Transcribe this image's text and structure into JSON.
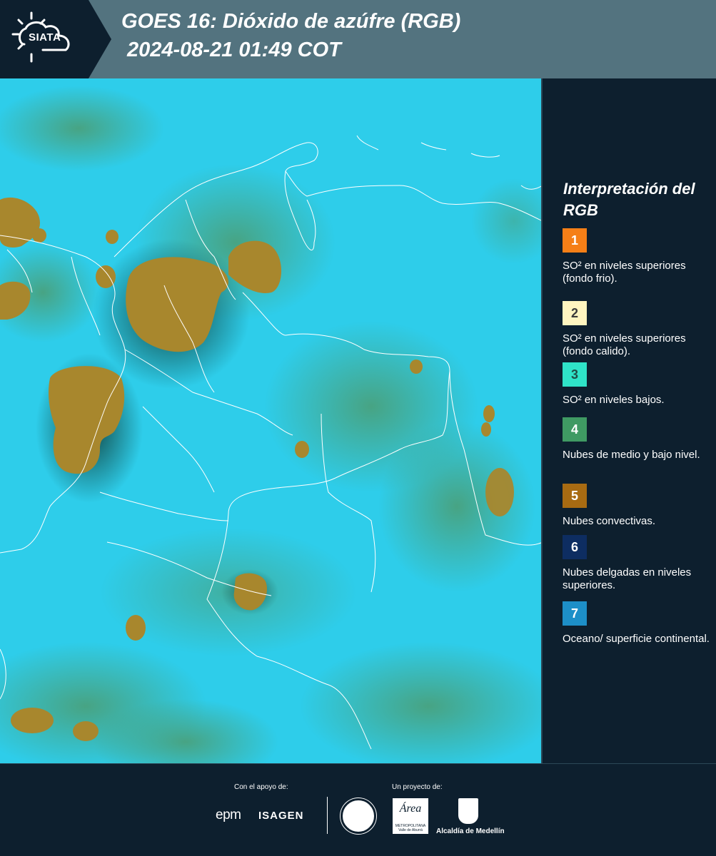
{
  "header": {
    "logo_text": "SIATA",
    "title_line1": "GOES 16: Dióxido de azúfre (RGB)",
    "title_line2": "2024-08-21 01:49 COT"
  },
  "legend": {
    "title": "Interpretación del RGB",
    "items": [
      {
        "number": "1",
        "text": "SO² en niveles superiores (fondo frio).",
        "color": "#f57f17",
        "text_color": "#ffffff"
      },
      {
        "number": "2",
        "text": "SO² en niveles superiores (fondo calido).",
        "color": "#fff5c0",
        "text_color": "#3a3a3a"
      },
      {
        "number": "3",
        "text": "SO² en niveles bajos.",
        "color": "#2fe3c8",
        "text_color": "#1f4d47"
      },
      {
        "number": "4",
        "text": "Nubes de medio y bajo nivel.",
        "color": "#3f9a63",
        "text_color": "#ffffff"
      },
      {
        "number": "5",
        "text": "Nubes convectivas.",
        "color": "#a86b12",
        "text_color": "#ffffff"
      },
      {
        "number": "6",
        "text": "Nubes delgadas en niveles superiores.",
        "color": "#0d2d61",
        "text_color": "#ffffff"
      },
      {
        "number": "7",
        "text": "Oceano/ superficie continental.",
        "color": "#1d8fc8",
        "text_color": "#ffffff"
      }
    ]
  },
  "footer": {
    "support_label": "Con el apoyo de:",
    "project_label": "Un proyecto de:",
    "epm": "epm",
    "isagen": "ISAGEN",
    "area_logo": "Área",
    "area_sub": "METROPOLITANA Valle de Aburrá",
    "alcaldia": "Alcaldía de Medellín"
  },
  "colors": {
    "background_dark": "#0d1f2e",
    "header_bar": "#53737f",
    "map_cyan": "#2ecdea",
    "convective_brown": "#a8872d",
    "mid_cloud_green": "#4aa588"
  }
}
